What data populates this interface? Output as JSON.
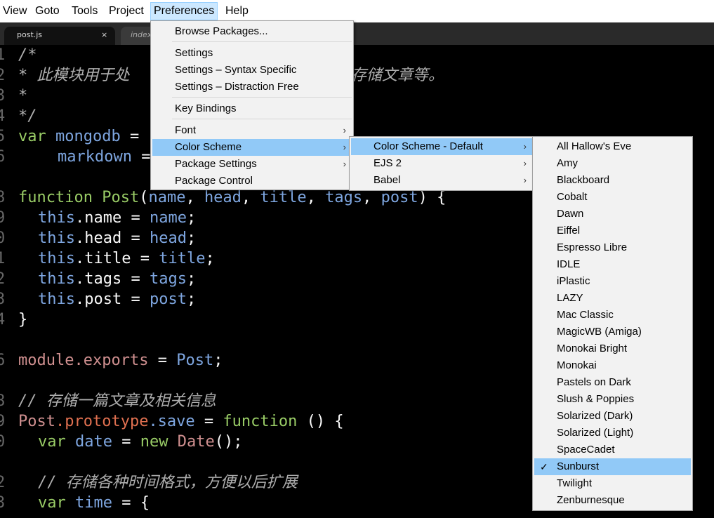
{
  "menubar": {
    "items": [
      "View",
      "Goto",
      "Tools",
      "Project",
      "Preferences",
      "Help"
    ]
  },
  "tabs": [
    {
      "label": "post.js",
      "close": "×"
    },
    {
      "label": "index.",
      "close": ""
    }
  ],
  "line_numbers": [
    "1",
    "2",
    "3",
    "4",
    "5",
    "6",
    "",
    "8",
    "9",
    "0",
    "1",
    "2",
    "3",
    "4",
    "",
    "6",
    "",
    "8",
    "9",
    "0",
    "",
    "2",
    "3"
  ],
  "code": {
    "l1": "/*",
    "l2a": "* 此模块用于处",
    "l2b": "括存储文章等。",
    "l3": "*",
    "l4": "*/",
    "l5_kw": "var",
    "l5_var": "mongodb",
    "l5_op": " =",
    "l6_var": "markdown",
    "l6_op": " =",
    "l8_kw": "function",
    "l8_fn": "Post",
    "l8_open": "(",
    "l8_p1": "name",
    "l8_c1": ", ",
    "l8_p2": "head",
    "l8_c2": ", ",
    "l8_p3": "title",
    "l8_c3": ", ",
    "l8_p4": "tags",
    "l8_c4": ", ",
    "l8_p5": "post",
    "l8_close": ") {",
    "this": "this",
    "l9_prop": ".name",
    "l9_val": "name",
    "l10_prop": ".head",
    "l10_val": "head",
    "l11_prop": ".title",
    "l11_val": "title",
    "l12_prop": ".tags",
    "l12_val": "tags",
    "l13_prop": ".post",
    "l13_val": "post",
    "eq": " = ",
    "semi": ";",
    "l14": "}",
    "l16_a": "module",
    "l16_b": ".exports",
    "l16_c": " = ",
    "l16_d": "Post",
    "l16_e": ";",
    "l18": "// 存储一篇文章及相关信息",
    "l19_a": "Post",
    "l19_b": ".prototype",
    "l19_c": ".save",
    "l19_d": " = ",
    "l19_e": "function",
    "l19_f": " () {",
    "l20_kw": "var",
    "l20_var": " date",
    "l20_eq": " = ",
    "l20_new": "new",
    "l20_date": " Date",
    "l20_end": "();",
    "l22": "// 存储各种时间格式，方便以后扩展",
    "l23_kw": "var",
    "l23_var": " time",
    "l23_end": " = {"
  },
  "preferences_menu": {
    "browse": "Browse Packages...",
    "settings": "Settings",
    "settings_syntax": "Settings – Syntax Specific",
    "settings_df": "Settings – Distraction Free",
    "key_bindings": "Key Bindings",
    "font": "Font",
    "color_scheme": "Color Scheme",
    "package_settings": "Package Settings",
    "package_control": "Package Control",
    "arrow": "›"
  },
  "color_scheme_menu": [
    "Color Scheme - Default",
    "EJS 2",
    "Babel"
  ],
  "default_schemes": {
    "items": [
      "All Hallow's Eve",
      "Amy",
      "Blackboard",
      "Cobalt",
      "Dawn",
      "Eiffel",
      "Espresso Libre",
      "IDLE",
      "iPlastic",
      "LAZY",
      "Mac Classic",
      "MagicWB (Amiga)",
      "Monokai Bright",
      "Monokai",
      "Pastels on Dark",
      "Slush & Poppies",
      "Solarized (Dark)",
      "Solarized (Light)",
      "SpaceCadet",
      "Sunburst",
      "Twilight",
      "Zenburnesque"
    ],
    "selected": "Sunburst",
    "check": "✓"
  }
}
